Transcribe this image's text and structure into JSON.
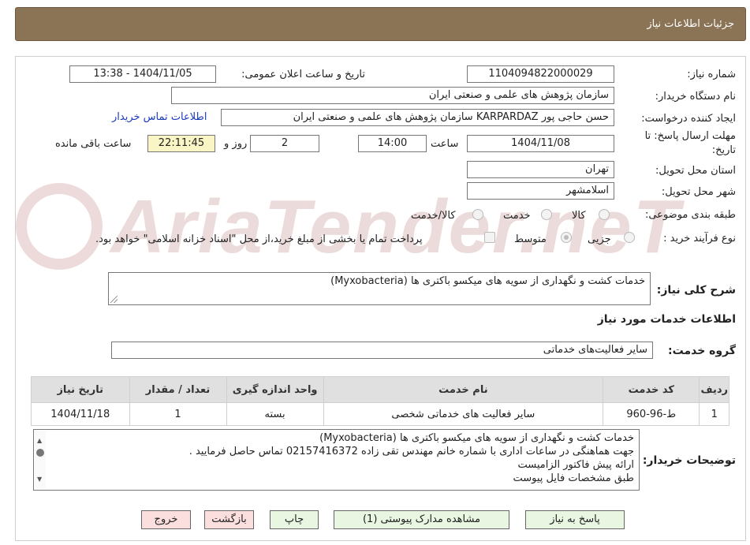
{
  "header": {
    "title": "جزئیات اطلاعات نیاز"
  },
  "form": {
    "need_number_label": "شماره نیاز:",
    "need_number": "1104094822000029",
    "announce_label": "تاریخ و ساعت اعلان عمومی:",
    "announce_value": "1404/11/05 - 13:38",
    "buyer_org_label": "نام دستگاه خریدار:",
    "buyer_org": "سازمان پژوهش های علمی و صنعتی ایران",
    "requester_label": "ایجاد کننده درخواست:",
    "requester": "حسن حاجی پور KARPARDAZ سازمان پژوهش های علمی و صنعتی ایران",
    "contact_link": "اطلاعات تماس خریدار",
    "deadline_label_1": "مهلت ارسال پاسخ: تا",
    "deadline_label_2": "تاریخ:",
    "deadline_date": "1404/11/08",
    "time_label": "ساعت",
    "deadline_time": "14:00",
    "days_value": "2",
    "days_label": "روز و",
    "remaining_time": "22:11:45",
    "remaining_label": "ساعت باقی مانده",
    "province_label": "استان محل تحویل:",
    "province": "تهران",
    "city_label": "شهر محل تحویل:",
    "city": "اسلامشهر",
    "category_label": "طبقه بندی موضوعی:",
    "category_options": [
      "کالا",
      "خدمت",
      "کالا/خدمت"
    ],
    "process_label": "نوع فرآیند خرید :",
    "process_options": [
      "جزیی",
      "متوسط"
    ],
    "payment_note": "پرداخت تمام یا بخشی از مبلغ خرید،از محل \"اسناد خزانه اسلامی\" خواهد بود.",
    "description_label": "شرح کلی نیاز:",
    "description": "خدمات کشت و نگهداری از سویه های  میکسو باکتری ها (Myxobacteria)"
  },
  "services": {
    "section_title": "اطلاعات خدمات مورد نیاز",
    "group_label": "گروه خدمت:",
    "group_value": "سایر فعالیت‌های خدماتی",
    "columns": [
      "ردیف",
      "کد خدمت",
      "نام خدمت",
      "واحد اندازه گیری",
      "تعداد / مقدار",
      "تاریخ نیاز"
    ],
    "rows": [
      [
        "1",
        "ط-96-960",
        "سایر فعالیت های خدماتی شخصی",
        "بسته",
        "1",
        "1404/11/18"
      ]
    ]
  },
  "buyer_notes": {
    "label": "توضیحات خریدار:",
    "lines": [
      "خدمات کشت و نگهداری از سویه های  میکسو باکتری ها (Myxobacteria)",
      "جهت هماهنگی در ساعات اداری با شماره خانم مهندس تقی زاده  02157416372 تماس حاصل فرمایید .",
      "ارائه پیش فاکتور الزامیست",
      "طبق مشخصات فایل پیوست"
    ]
  },
  "buttons": {
    "reply": "پاسخ به نیاز",
    "attachments": "مشاهده مدارک پیوستی (1)",
    "print": "چاپ",
    "back": "بازگشت",
    "exit": "خروج"
  },
  "watermark": {
    "text": "AriaTender.neT"
  },
  "colors": {
    "header_bg": "#8b7355",
    "button_green": "#e8f6e2",
    "button_red": "#fbdede",
    "link": "#1a3ab8"
  }
}
